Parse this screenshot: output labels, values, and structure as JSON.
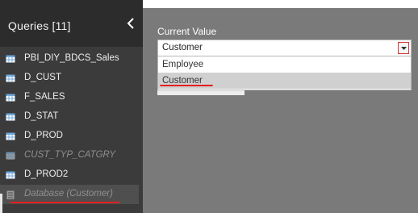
{
  "sidebar": {
    "title": "Queries [11]",
    "collapse_icon": "chevron-left-icon",
    "items": [
      {
        "label": "PBI_DIY_BDCS_Sales",
        "icon": "table-icon",
        "disabled": false,
        "selected": false
      },
      {
        "label": "D_CUST",
        "icon": "table-icon",
        "disabled": false,
        "selected": false
      },
      {
        "label": "F_SALES",
        "icon": "table-icon",
        "disabled": false,
        "selected": false
      },
      {
        "label": "D_STAT",
        "icon": "table-icon",
        "disabled": false,
        "selected": false
      },
      {
        "label": "D_PROD",
        "icon": "table-icon",
        "disabled": false,
        "selected": false
      },
      {
        "label": "CUST_TYP_CATGRY",
        "icon": "table-icon",
        "disabled": true,
        "selected": false
      },
      {
        "label": "D_PROD2",
        "icon": "table-icon",
        "disabled": false,
        "selected": false
      },
      {
        "label": "Database (Customer)",
        "icon": "parameter-icon",
        "disabled": true,
        "selected": true
      }
    ]
  },
  "main": {
    "current_value_label": "Current Value",
    "dropdown": {
      "value": "Customer",
      "options": [
        "Employee",
        "Customer"
      ],
      "highlighted_option": "Customer"
    }
  },
  "colors": {
    "sidebar_bg": "#3b3b3b",
    "header_bg": "#2c2c2c",
    "panel_bg": "#7a7a7a",
    "annotation_red": "#e41f1f"
  }
}
